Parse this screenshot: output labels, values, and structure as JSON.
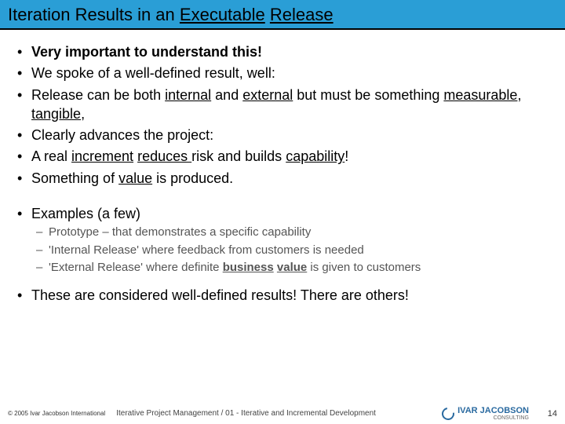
{
  "title": {
    "pre": "Iteration Results in an ",
    "u1": "Executable",
    "sep": " ",
    "u2": "Release"
  },
  "bullets": {
    "b1": "Very important to understand this!",
    "b2": "We spoke of a well-defined result, well:",
    "b3": {
      "pre": "Release can be both ",
      "u1": "internal",
      "mid1": " and ",
      "u2": "external",
      "mid2": " but must be something ",
      "u3": "measurable",
      "mid3": ", ",
      "u4": "tangible",
      "post": ","
    },
    "b4": "Clearly advances the project:",
    "b5": {
      "pre": "A real ",
      "u1": "increment",
      "sp": " ",
      "u2": "reduces ",
      "mid": " risk and builds ",
      "u3": "capability",
      "post": "!"
    },
    "b6": {
      "pre": "Something of ",
      "u1": "value",
      "post": " is produced."
    },
    "b7": "Examples  (a few)",
    "s1": "Prototype – that demonstrates a specific capability",
    "s2": "'Internal Release' where feedback from customers is needed",
    "s3": {
      "pre": "'External Release' where definite ",
      "u1": "business",
      "sp": " ",
      "u2": "value",
      "post": " is given to customers"
    },
    "b8": "These are considered well-defined results!  There are others!"
  },
  "footer": {
    "copyright": "© 2005 Ivar Jacobson International",
    "middle": "Iterative Project Management / 01 - Iterative and Incremental Development",
    "logo_main": "IVAR JACOBSON",
    "logo_sub": "CONSULTING",
    "page": "14"
  }
}
